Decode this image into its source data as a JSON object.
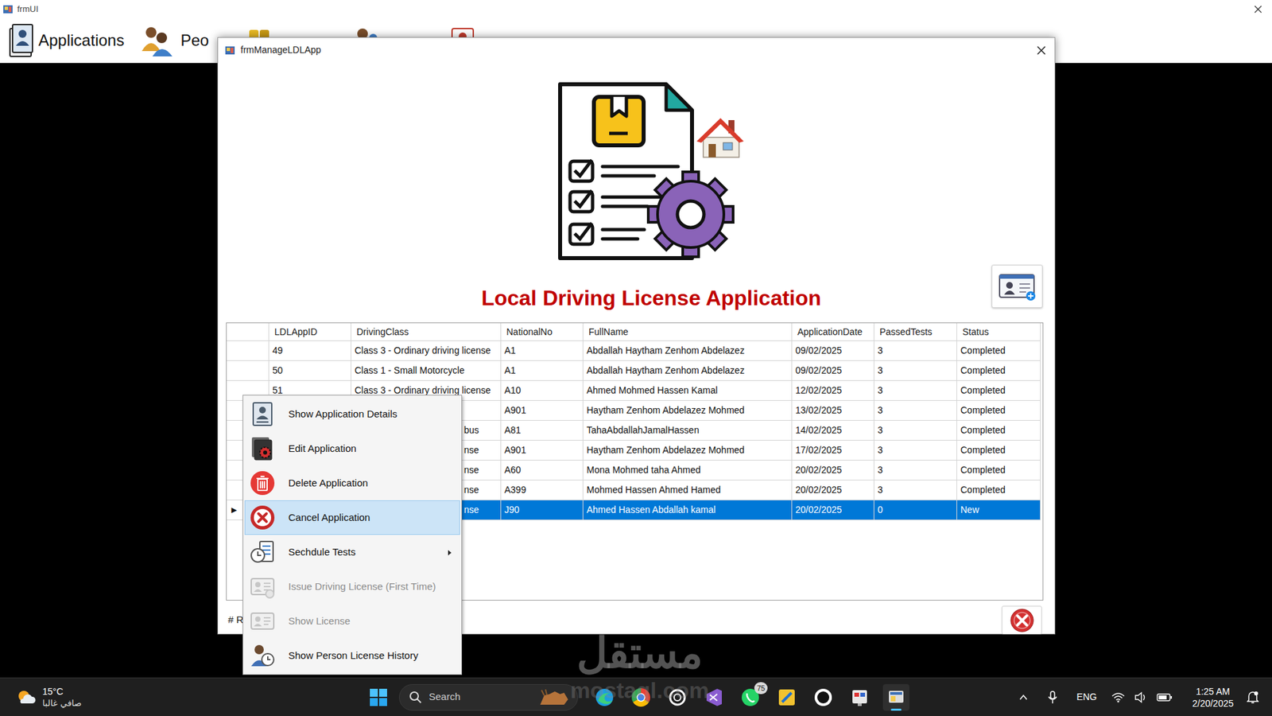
{
  "parent_window": {
    "title": "frmUI",
    "menu": [
      {
        "label": "Applications"
      },
      {
        "label": "Peo"
      }
    ]
  },
  "dialog": {
    "title": "frmManageLDLApp",
    "heading": "Local Driving License Application",
    "records_label": "# R"
  },
  "table": {
    "columns": [
      "LDLAppID",
      "DrivingClass",
      "NationalNo",
      "FullName",
      "ApplicationDate",
      "PassedTests",
      "Status"
    ],
    "rows": [
      {
        "marker": "",
        "selected": false,
        "cells": [
          "49",
          "Class 3 - Ordinary driving license",
          "A1",
          "Abdallah Haytham Zenhom Abdelazez",
          "09/02/2025",
          "3",
          "Completed"
        ]
      },
      {
        "marker": "",
        "selected": false,
        "cells": [
          "50",
          "Class 1 - Small Motorcycle",
          "A1",
          "Abdallah Haytham Zenhom Abdelazez",
          "09/02/2025",
          "3",
          "Completed"
        ]
      },
      {
        "marker": "",
        "selected": false,
        "cells": [
          "51",
          "Class 3 - Ordinary driving license",
          "A10",
          "Ahmed Mohmed Hassen Kamal",
          "12/02/2025",
          "3",
          "Completed"
        ]
      },
      {
        "marker": "",
        "selected": false,
        "cells": [
          "",
          "",
          "A901",
          "Haytham Zenhom Abdelazez Mohmed",
          "13/02/2025",
          "3",
          "Completed"
        ]
      },
      {
        "marker": "",
        "selected": false,
        "cells": [
          "",
          "bus",
          "A81",
          "TahaAbdallahJamalHassen",
          "14/02/2025",
          "3",
          "Completed"
        ]
      },
      {
        "marker": "",
        "selected": false,
        "cells": [
          "",
          "nse",
          "A901",
          "Haytham Zenhom Abdelazez Mohmed",
          "17/02/2025",
          "3",
          "Completed"
        ]
      },
      {
        "marker": "",
        "selected": false,
        "cells": [
          "",
          "nse",
          "A60",
          "Mona Mohmed taha Ahmed",
          "20/02/2025",
          "3",
          "Completed"
        ]
      },
      {
        "marker": "",
        "selected": false,
        "cells": [
          "",
          "nse",
          "A399",
          "Mohmed Hassen Ahmed Hamed",
          "20/02/2025",
          "3",
          "Completed"
        ]
      },
      {
        "marker": "▶",
        "selected": true,
        "cells": [
          "",
          "nse",
          "J90",
          "Ahmed Hassen Abdallah kamal",
          "20/02/2025",
          "0",
          "New"
        ]
      }
    ]
  },
  "context_menu": {
    "items": [
      {
        "label": "Show Application Details",
        "disabled": false,
        "selected": false,
        "submenu": false
      },
      {
        "label": "Edit Application",
        "disabled": false,
        "selected": false,
        "submenu": false
      },
      {
        "label": "Delete Application",
        "disabled": false,
        "selected": false,
        "submenu": false
      },
      {
        "label": "Cancel Application",
        "disabled": false,
        "selected": true,
        "submenu": false
      },
      {
        "label": "Sechdule Tests",
        "disabled": false,
        "selected": false,
        "submenu": true
      },
      {
        "label": "Issue Driving License (First Time)",
        "disabled": true,
        "selected": false,
        "submenu": false
      },
      {
        "label": "Show License",
        "disabled": true,
        "selected": false,
        "submenu": false
      },
      {
        "label": "Show Person License History",
        "disabled": false,
        "selected": false,
        "submenu": false
      }
    ]
  },
  "taskbar": {
    "weather": {
      "temp": "15°C",
      "condition": "صافي غالبا"
    },
    "search": {
      "placeholder": "Search"
    },
    "whatsapp_badge": "75",
    "tray": {
      "language": "ENG",
      "time": "1:25 AM",
      "date": "2/20/2025"
    }
  },
  "watermark": {
    "arabic": "مستقل",
    "latin": "mostaql.com"
  }
}
